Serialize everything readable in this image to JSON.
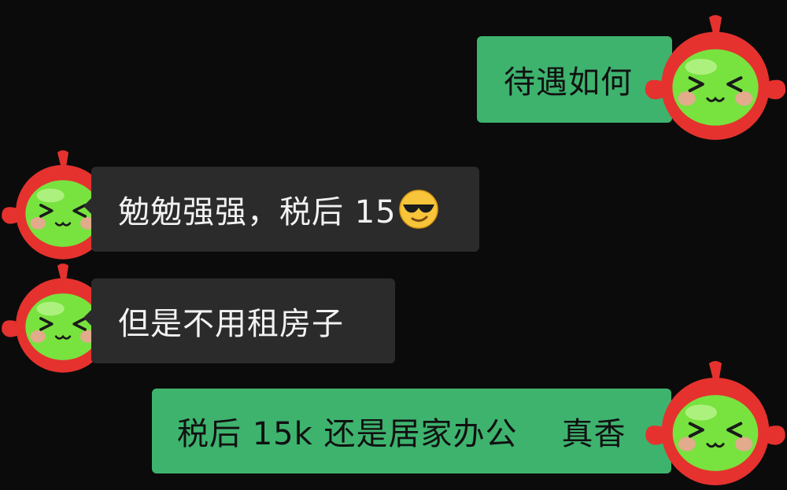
{
  "messages": [
    {
      "side": "out",
      "text": "待遇如何",
      "avatar_icon": "red-green-mascot-icon"
    },
    {
      "side": "in",
      "text": "勉勉强强，税后 15",
      "emoji": "sunglasses-smile-emoji-icon",
      "avatar_icon": "red-green-mascot-icon"
    },
    {
      "side": "in",
      "text": "但是不用租房子",
      "avatar_icon": "red-green-mascot-icon"
    },
    {
      "side": "out",
      "text": "税后 15k 还是居家办公",
      "text2": "真香",
      "avatar_icon": "red-green-mascot-icon"
    }
  ],
  "colors": {
    "background": "#0b0b0b",
    "outgoing_bubble": "#3eb36e",
    "incoming_bubble": "#2b2b2b",
    "mascot_red": "#e5322e",
    "mascot_green": "#78e23f"
  }
}
